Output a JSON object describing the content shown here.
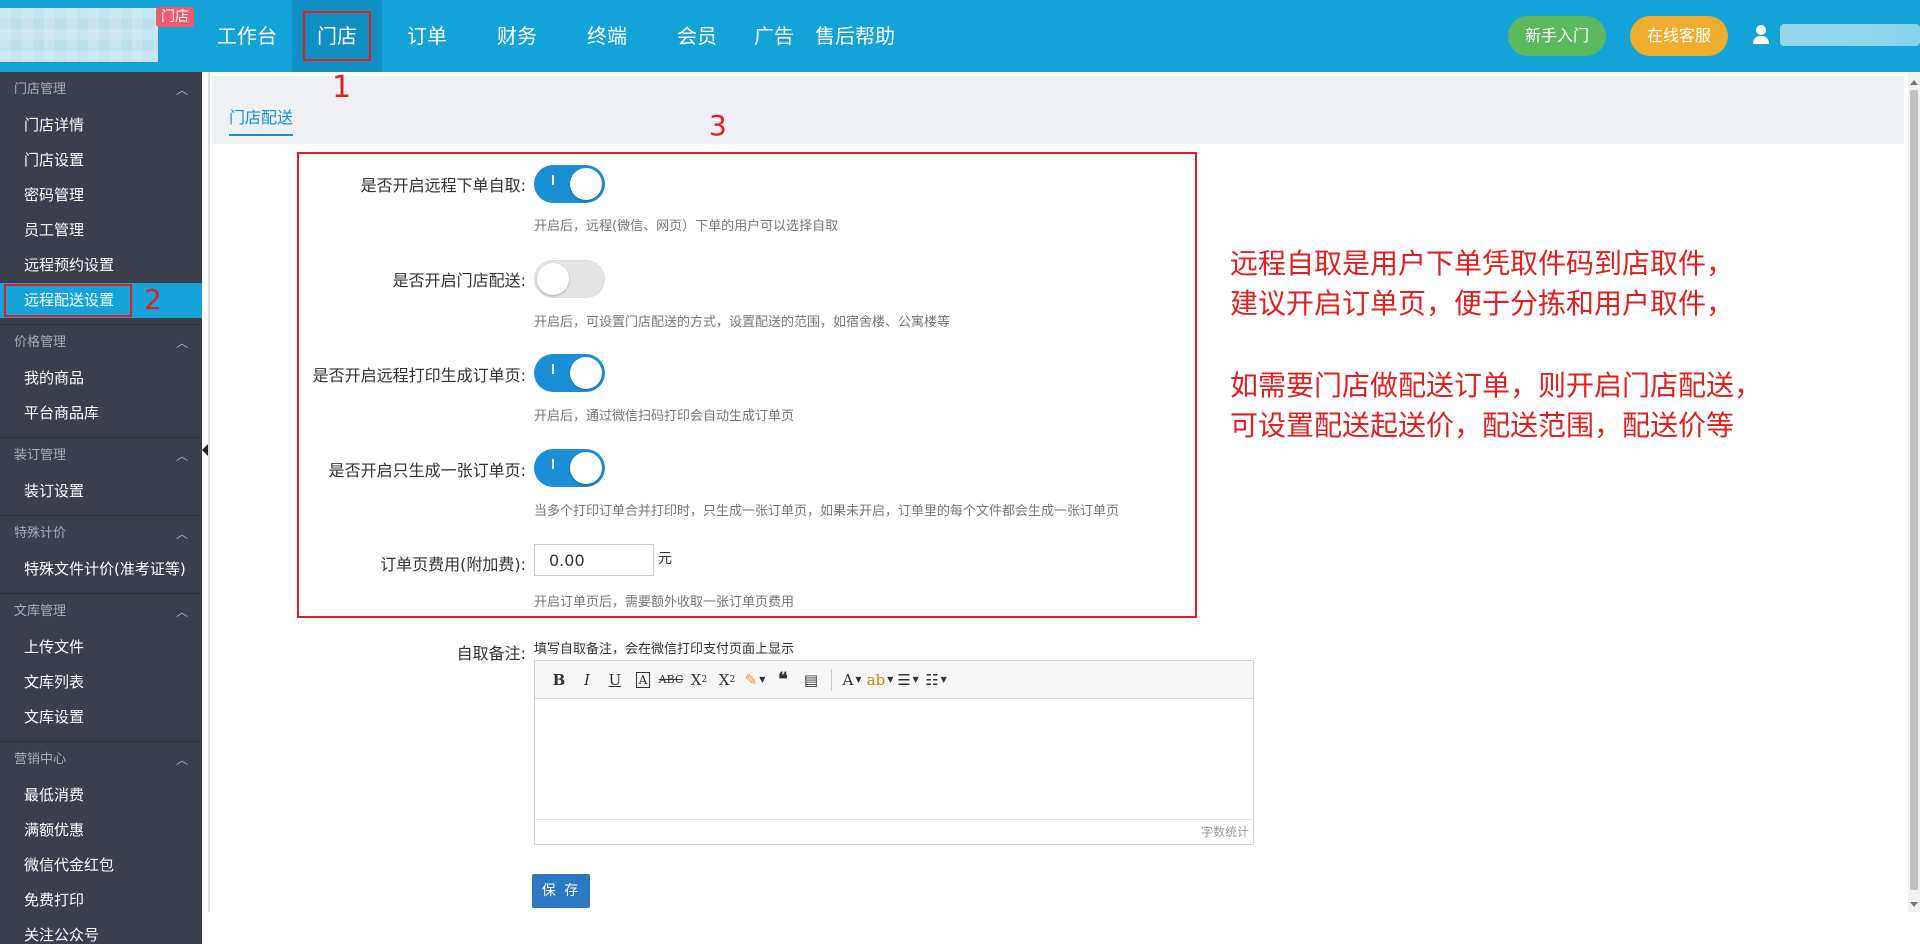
{
  "header": {
    "logo_badge": "门店",
    "nav": [
      "工作台",
      "门店",
      "订单",
      "财务",
      "终端",
      "会员",
      "广告",
      "售后帮助"
    ],
    "active_nav_index": 1,
    "guide_button": "新手入门",
    "service_button": "在线客服",
    "colors": {
      "bar": "#14a3d8",
      "guide": "#5cb85c",
      "service": "#f0ad2d"
    }
  },
  "sidebar": {
    "groups": [
      {
        "title": "门店管理",
        "items": [
          "门店详情",
          "门店设置",
          "密码管理",
          "员工管理",
          "远程预约设置",
          "远程配送设置"
        ]
      },
      {
        "title": "价格管理",
        "items": [
          "我的商品",
          "平台商品库"
        ]
      },
      {
        "title": "装订管理",
        "items": [
          "装订设置"
        ]
      },
      {
        "title": "特殊计价",
        "items": [
          "特殊文件计价(准考证等)"
        ]
      },
      {
        "title": "文库管理",
        "items": [
          "上传文件",
          "文库列表",
          "文库设置"
        ]
      },
      {
        "title": "营销中心",
        "items": [
          "最低消费",
          "满额优惠",
          "微信代金红包",
          "免费打印",
          "关注公众号"
        ]
      }
    ],
    "active_item": "远程配送设置"
  },
  "annotations": {
    "a1": "1",
    "a2": "2",
    "a3": "3"
  },
  "tab": {
    "label": "门店配送"
  },
  "form": {
    "remote_pickup": {
      "label": "是否开启远程下单自取:",
      "on": true,
      "help": "开启后，远程(微信、网页）下单的用户可以选择自取"
    },
    "store_delivery": {
      "label": "是否开启门店配送:",
      "on": false,
      "help": "开启后，可设置门店配送的方式，设置配送的范围，如宿舍楼、公寓楼等"
    },
    "remote_print_order": {
      "label": "是否开启远程打印生成订单页:",
      "on": true,
      "help": "开启后，通过微信扫码打印会自动生成订单页"
    },
    "single_order_page": {
      "label": "是否开启只生成一张订单页:",
      "on": true,
      "help": "当多个打印订单合并打印时，只生成一张订单页，如果未开启，订单里的每个文件都会生成一张订单页"
    },
    "order_fee": {
      "label": "订单页费用(附加费):",
      "value": "0.00",
      "unit": "元",
      "help": "开启订单页后，需要额外收取一张订单页费用"
    },
    "remark": {
      "label": "自取备注:",
      "hint": "填写自取备注，会在微信打印支付页面上显示",
      "word_count": "字数统计"
    },
    "save": "保 存"
  },
  "note": {
    "lines": [
      "远程自取是用户下单凭取件码到店取件，",
      "建议开启订单页，便于分拣和用户取件，",
      "如需要门店做配送订单，则开启门店配送，",
      "可设置配送起送价，配送范围，配送价等"
    ]
  },
  "toolbar_icons": [
    "bold-icon",
    "italic-icon",
    "underline-icon",
    "font-border-icon",
    "strikethrough-icon",
    "superscript-icon",
    "subscript-icon",
    "magic-wand-icon",
    "blockquote-icon",
    "paste-text-icon",
    "font-color-icon",
    "background-color-icon",
    "ordered-list-icon",
    "unordered-list-icon"
  ]
}
